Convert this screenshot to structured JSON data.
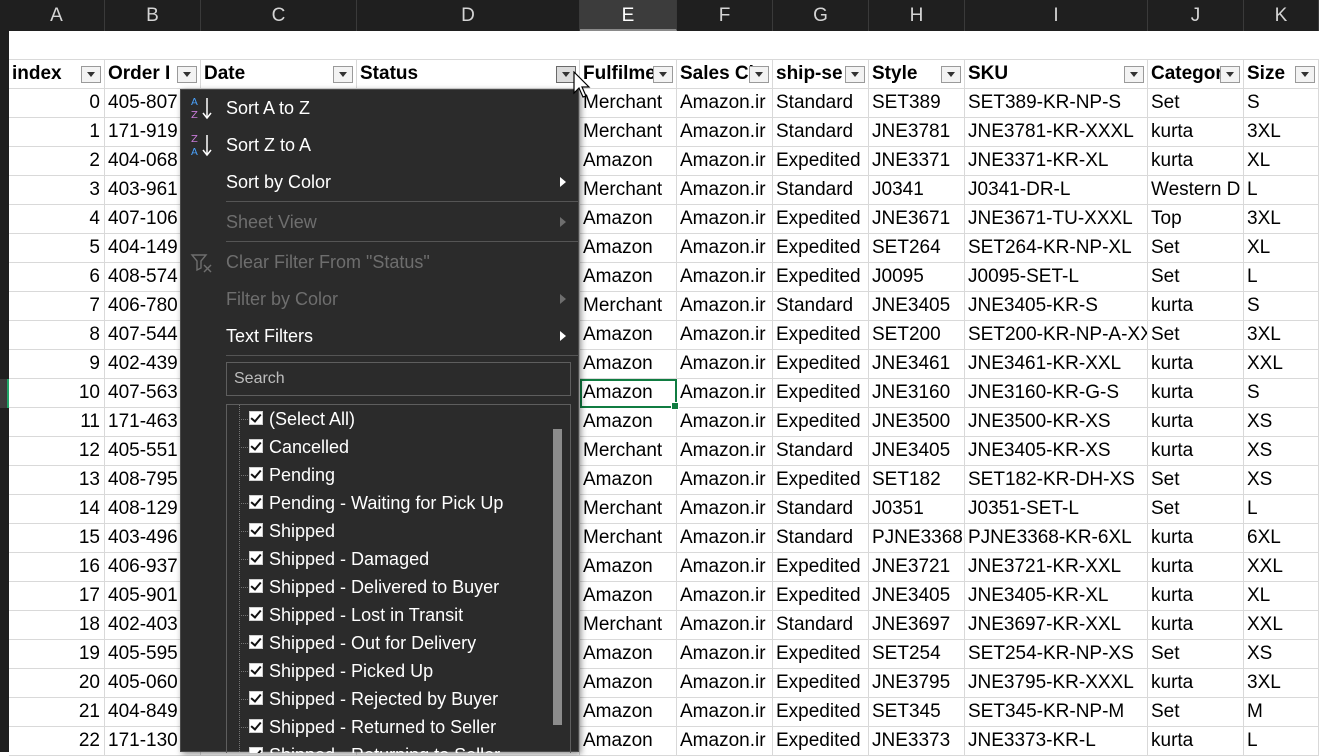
{
  "columns": [
    "A",
    "B",
    "C",
    "D",
    "E",
    "F",
    "G",
    "H",
    "I",
    "J",
    "K"
  ],
  "selected_column": "E",
  "headers": [
    "index",
    "Order I",
    "Date",
    "Status",
    "Fulfilme",
    "Sales Cl",
    "ship-se",
    "Style",
    "SKU",
    "Categor",
    "Size"
  ],
  "rows": [
    [
      "0",
      "405-807",
      "",
      "",
      "Merchant",
      "Amazon.ir",
      "Standard",
      "SET389",
      "SET389-KR-NP-S",
      "Set",
      "S"
    ],
    [
      "1",
      "171-919",
      "",
      "",
      "Merchant",
      "Amazon.ir",
      "Standard",
      "JNE3781",
      "JNE3781-KR-XXXL",
      "kurta",
      "3XL"
    ],
    [
      "2",
      "404-068",
      "",
      "",
      "Amazon",
      "Amazon.ir",
      "Expedited",
      "JNE3371",
      "JNE3371-KR-XL",
      "kurta",
      "XL"
    ],
    [
      "3",
      "403-961",
      "",
      "",
      "Merchant",
      "Amazon.ir",
      "Standard",
      "J0341",
      "J0341-DR-L",
      "Western D",
      "L"
    ],
    [
      "4",
      "407-106",
      "",
      "",
      "Amazon",
      "Amazon.ir",
      "Expedited",
      "JNE3671",
      "JNE3671-TU-XXXL",
      "Top",
      "3XL"
    ],
    [
      "5",
      "404-149",
      "",
      "",
      "Amazon",
      "Amazon.ir",
      "Expedited",
      "SET264",
      "SET264-KR-NP-XL",
      "Set",
      "XL"
    ],
    [
      "6",
      "408-574",
      "",
      "",
      "Amazon",
      "Amazon.ir",
      "Expedited",
      "J0095",
      "J0095-SET-L",
      "Set",
      "L"
    ],
    [
      "7",
      "406-780",
      "",
      "",
      "Merchant",
      "Amazon.ir",
      "Standard",
      "JNE3405",
      "JNE3405-KR-S",
      "kurta",
      "S"
    ],
    [
      "8",
      "407-544",
      "",
      "",
      "Amazon",
      "Amazon.ir",
      "Expedited",
      "SET200",
      "SET200-KR-NP-A-XX",
      "Set",
      "3XL"
    ],
    [
      "9",
      "402-439",
      "",
      "",
      "Amazon",
      "Amazon.ir",
      "Expedited",
      "JNE3461",
      "JNE3461-KR-XXL",
      "kurta",
      "XXL"
    ],
    [
      "10",
      "407-563",
      "",
      "",
      "Amazon",
      "Amazon.ir",
      "Expedited",
      "JNE3160",
      "JNE3160-KR-G-S",
      "kurta",
      "S"
    ],
    [
      "11",
      "171-463",
      "",
      "",
      "Amazon",
      "Amazon.ir",
      "Expedited",
      "JNE3500",
      "JNE3500-KR-XS",
      "kurta",
      "XS"
    ],
    [
      "12",
      "405-551",
      "",
      "",
      "Merchant",
      "Amazon.ir",
      "Standard",
      "JNE3405",
      "JNE3405-KR-XS",
      "kurta",
      "XS"
    ],
    [
      "13",
      "408-795",
      "",
      "",
      "Amazon",
      "Amazon.ir",
      "Expedited",
      "SET182",
      "SET182-KR-DH-XS",
      "Set",
      "XS"
    ],
    [
      "14",
      "408-129",
      "",
      "",
      "Merchant",
      "Amazon.ir",
      "Standard",
      "J0351",
      "J0351-SET-L",
      "Set",
      "L"
    ],
    [
      "15",
      "403-496",
      "",
      "",
      "Merchant",
      "Amazon.ir",
      "Standard",
      "PJNE3368",
      "PJNE3368-KR-6XL",
      "kurta",
      "6XL"
    ],
    [
      "16",
      "406-937",
      "",
      "",
      "Amazon",
      "Amazon.ir",
      "Expedited",
      "JNE3721",
      "JNE3721-KR-XXL",
      "kurta",
      "XXL"
    ],
    [
      "17",
      "405-901",
      "",
      "",
      "Amazon",
      "Amazon.ir",
      "Expedited",
      "JNE3405",
      "JNE3405-KR-XL",
      "kurta",
      "XL"
    ],
    [
      "18",
      "402-403",
      "",
      "",
      "Merchant",
      "Amazon.ir",
      "Standard",
      "JNE3697",
      "JNE3697-KR-XXL",
      "kurta",
      "XXL"
    ],
    [
      "19",
      "405-595",
      "",
      "",
      "Amazon",
      "Amazon.ir",
      "Expedited",
      "SET254",
      "SET254-KR-NP-XS",
      "Set",
      "XS"
    ],
    [
      "20",
      "405-060",
      "",
      "",
      "Amazon",
      "Amazon.ir",
      "Expedited",
      "JNE3795",
      "JNE3795-KR-XXXL",
      "kurta",
      "3XL"
    ],
    [
      "21",
      "404-849",
      "",
      "",
      "Amazon",
      "Amazon.ir",
      "Expedited",
      "SET345",
      "SET345-KR-NP-M",
      "Set",
      "M"
    ],
    [
      "22",
      "171-130",
      "",
      "",
      "Amazon",
      "Amazon.ir",
      "Expedited",
      "JNE3373",
      "JNE3373-KR-L",
      "kurta",
      "L"
    ]
  ],
  "active_cell": "E11",
  "menu": {
    "sort_az": "Sort A to Z",
    "sort_za": "Sort Z to A",
    "sort_color": "Sort by Color",
    "sheet_view": "Sheet View",
    "clear_filter": "Clear Filter From \"Status\"",
    "filter_color": "Filter by Color",
    "text_filters": "Text Filters",
    "search_placeholder": "Search",
    "items": [
      {
        "label": "(Select All)",
        "checked": true
      },
      {
        "label": "Cancelled",
        "checked": true
      },
      {
        "label": "Pending",
        "checked": true
      },
      {
        "label": "Pending - Waiting for Pick Up",
        "checked": true
      },
      {
        "label": "Shipped",
        "checked": true
      },
      {
        "label": "Shipped - Damaged",
        "checked": true
      },
      {
        "label": "Shipped - Delivered to Buyer",
        "checked": true
      },
      {
        "label": "Shipped - Lost in Transit",
        "checked": true
      },
      {
        "label": "Shipped - Out for Delivery",
        "checked": true
      },
      {
        "label": "Shipped - Picked Up",
        "checked": true
      },
      {
        "label": "Shipped - Rejected by Buyer",
        "checked": true
      },
      {
        "label": "Shipped - Returned to Seller",
        "checked": true
      },
      {
        "label": "Shipped - Returning to Seller",
        "checked": true
      }
    ]
  },
  "colors": {
    "accent": "#107c41",
    "menu_bg": "#2b2b2b",
    "header_bg": "#1f1f1f"
  }
}
